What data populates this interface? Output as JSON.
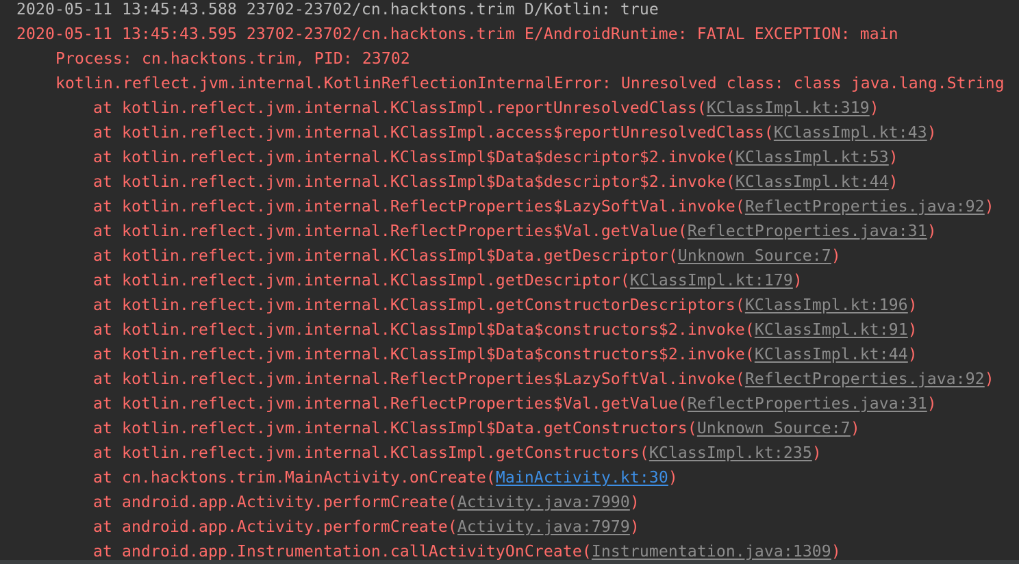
{
  "logcat": {
    "lines": [
      {
        "level": "D",
        "text": "2020-05-11 13:45:43.588 23702-23702/cn.hacktons.trim D/Kotlin: true"
      },
      {
        "level": "E",
        "text": "2020-05-11 13:45:43.595 23702-23702/cn.hacktons.trim E/AndroidRuntime: FATAL EXCEPTION: main"
      },
      {
        "level": "E",
        "text": "Process: cn.hacktons.trim, PID: 23702"
      },
      {
        "level": "E",
        "text": "kotlin.reflect.jvm.internal.KotlinReflectionInternalError: Unresolved class: class java.lang.String"
      }
    ],
    "stack": [
      {
        "method": "kotlin.reflect.jvm.internal.KClassImpl.reportUnresolvedClass",
        "source": "KClassImpl.kt:319"
      },
      {
        "method": "kotlin.reflect.jvm.internal.KClassImpl.access$reportUnresolvedClass",
        "source": "KClassImpl.kt:43"
      },
      {
        "method": "kotlin.reflect.jvm.internal.KClassImpl$Data$descriptor$2.invoke",
        "source": "KClassImpl.kt:53"
      },
      {
        "method": "kotlin.reflect.jvm.internal.KClassImpl$Data$descriptor$2.invoke",
        "source": "KClassImpl.kt:44"
      },
      {
        "method": "kotlin.reflect.jvm.internal.ReflectProperties$LazySoftVal.invoke",
        "source": "ReflectProperties.java:92"
      },
      {
        "method": "kotlin.reflect.jvm.internal.ReflectProperties$Val.getValue",
        "source": "ReflectProperties.java:31"
      },
      {
        "method": "kotlin.reflect.jvm.internal.KClassImpl$Data.getDescriptor",
        "source": "Unknown Source:7"
      },
      {
        "method": "kotlin.reflect.jvm.internal.KClassImpl.getDescriptor",
        "source": "KClassImpl.kt:179"
      },
      {
        "method": "kotlin.reflect.jvm.internal.KClassImpl.getConstructorDescriptors",
        "source": "KClassImpl.kt:196"
      },
      {
        "method": "kotlin.reflect.jvm.internal.KClassImpl$Data$constructors$2.invoke",
        "source": "KClassImpl.kt:91"
      },
      {
        "method": "kotlin.reflect.jvm.internal.KClassImpl$Data$constructors$2.invoke",
        "source": "KClassImpl.kt:44"
      },
      {
        "method": "kotlin.reflect.jvm.internal.ReflectProperties$LazySoftVal.invoke",
        "source": "ReflectProperties.java:92"
      },
      {
        "method": "kotlin.reflect.jvm.internal.ReflectProperties$Val.getValue",
        "source": "ReflectProperties.java:31"
      },
      {
        "method": "kotlin.reflect.jvm.internal.KClassImpl$Data.getConstructors",
        "source": "Unknown Source:7"
      },
      {
        "method": "kotlin.reflect.jvm.internal.KClassImpl.getConstructors",
        "source": "KClassImpl.kt:235"
      },
      {
        "method": "cn.hacktons.trim.MainActivity.onCreate",
        "source": "MainActivity.kt:30",
        "highlight": true
      },
      {
        "method": "android.app.Activity.performCreate",
        "source": "Activity.java:7990"
      },
      {
        "method": "android.app.Activity.performCreate",
        "source": "Activity.java:7979"
      },
      {
        "method": "android.app.Instrumentation.callActivityOnCreate",
        "source": "Instrumentation.java:1309"
      }
    ],
    "at_prefix": "at ",
    "open_paren": "(",
    "close_paren": ")"
  },
  "colors": {
    "background": "#2b2b2b",
    "debug_text": "#bbbbbb",
    "error_text": "#ff6b68",
    "source_link": "#8c8c8c",
    "app_source_link": "#3d8fe6"
  }
}
